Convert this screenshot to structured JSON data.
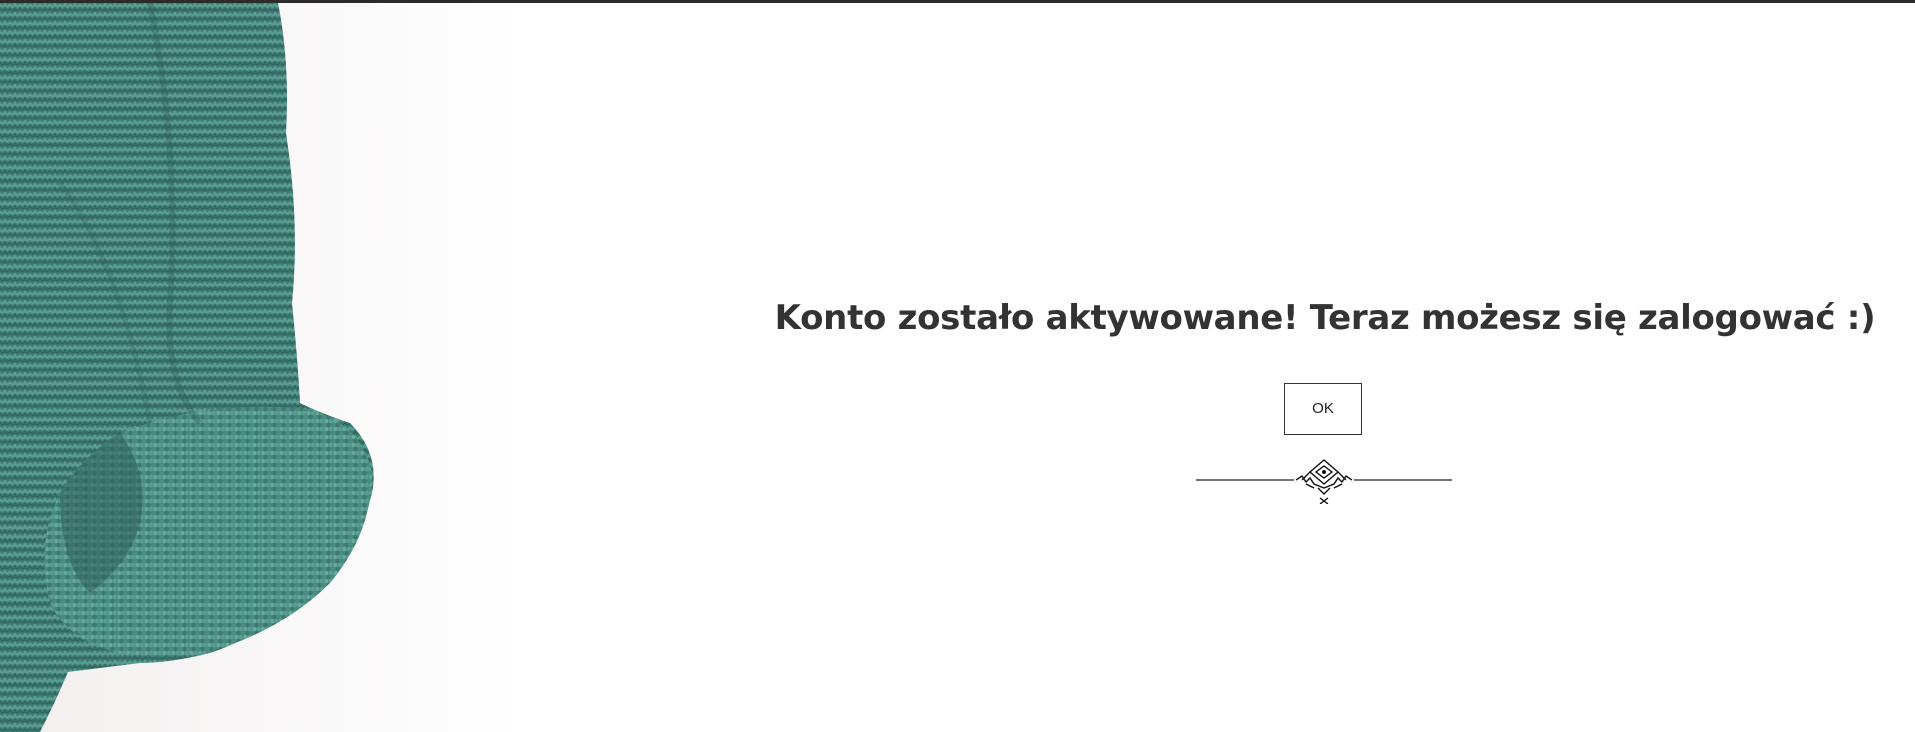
{
  "page": {
    "background_color": "#ffffff",
    "top_border_color": "#2b2b2b"
  },
  "hero": {
    "image_icon": "knit-sweater-sleeve-image",
    "knit_color": "#4a8a80"
  },
  "message": {
    "title": "Konto zostało aktywowane! Teraz możesz się zalogować :)",
    "text_color": "#333333"
  },
  "actions": {
    "ok_label": "OK"
  },
  "decoration": {
    "divider_icon": "ornamental-divider-icon"
  }
}
